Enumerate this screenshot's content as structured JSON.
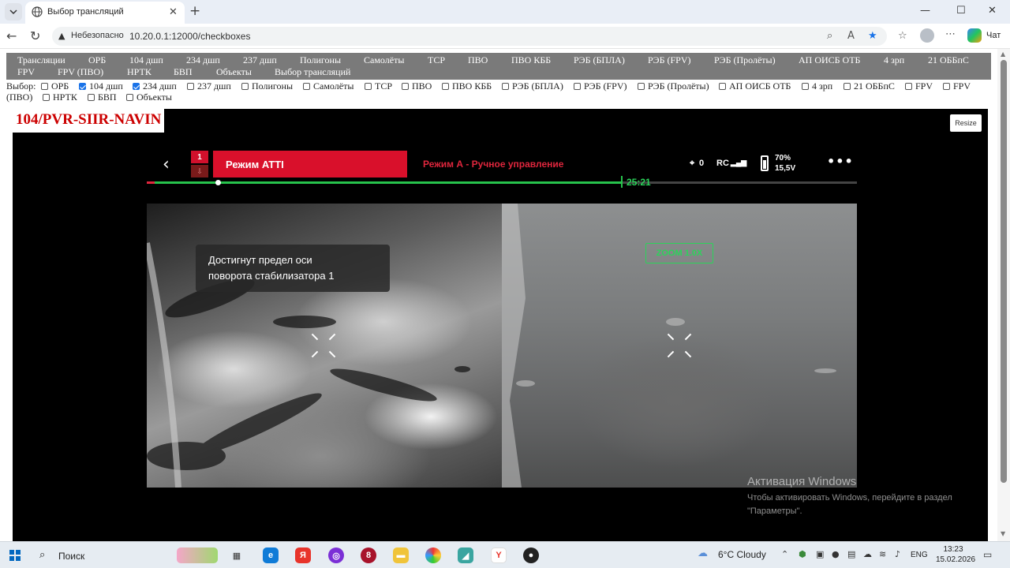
{
  "browser": {
    "tab_title": "Выбор трансляций",
    "tab_close": "✕",
    "new_tab": "+",
    "window_controls": [
      "—",
      "☐",
      "✕"
    ],
    "address": {
      "security_label": "Небезопасно",
      "url": "10.20.0.1:12000/checkboxes"
    },
    "chat_label": "Чат"
  },
  "menu": {
    "items": [
      "Трансляции",
      "ОРБ",
      "104 дшп",
      "234 дшп",
      "237 дшп",
      "Полигоны",
      "Самолёты",
      "ТСР",
      "ПВО",
      "ПВО КББ",
      "РЭБ (БПЛА)",
      "РЭБ (FPV)",
      "РЭБ (Пролёты)",
      "АП ОИСБ ОТБ",
      "4 зрп",
      "21 ОББпС",
      "FPV",
      "FPV (ПВО)",
      "НРТК",
      "БВП",
      "Объекты",
      "Выбор трансляций"
    ]
  },
  "selection": {
    "label": "Выбор:",
    "options": [
      {
        "label": "ОРБ",
        "checked": false
      },
      {
        "label": "104 дшп",
        "checked": true
      },
      {
        "label": "234 дшп",
        "checked": true
      },
      {
        "label": "237 дшп",
        "checked": false
      },
      {
        "label": "Полигоны",
        "checked": false
      },
      {
        "label": "Самолёты",
        "checked": false
      },
      {
        "label": "ТСР",
        "checked": false
      },
      {
        "label": "ПВО",
        "checked": false
      },
      {
        "label": "ПВО КББ",
        "checked": false
      },
      {
        "label": "РЭБ (БПЛА)",
        "checked": false
      },
      {
        "label": "РЭБ (FPV)",
        "checked": false
      },
      {
        "label": "РЭБ (Пролёты)",
        "checked": false
      },
      {
        "label": "АП ОИСБ ОТБ",
        "checked": false
      },
      {
        "label": "4 зрп",
        "checked": false
      },
      {
        "label": "21 ОББпС",
        "checked": false
      },
      {
        "label": "FPV",
        "checked": false
      },
      {
        "label": "FPV",
        "checked": false
      },
      {
        "label": "НРТК",
        "checked": false
      },
      {
        "label": "БВП",
        "checked": false
      },
      {
        "label": "Объекты",
        "checked": false
      }
    ],
    "wrap_text": "(ПВО)"
  },
  "stream": {
    "title": "104/PVR-SIIR-NAVIN",
    "resize_label": "Resize",
    "hud": {
      "back": "‹",
      "badge_top": "1",
      "badge_bottom": "⇩",
      "mode": "Режим ATTI",
      "mode_sub": "Режим А - Ручное управление",
      "satellites": "0",
      "rc": "RC",
      "battery_percent": "70%",
      "battery_voltage": "15,5V",
      "more": "•••",
      "timer": "25:21",
      "progress": 0.67,
      "notice_line1": "Достигнут предел оси",
      "notice_line2": "поворота стабилизатора 1",
      "zoom": "ZOOM 1.0X"
    }
  },
  "watermark": {
    "title": "Активация Windows",
    "text": "Чтобы активировать Windows, перейдите в раздел \"Параметры\"."
  },
  "taskbar": {
    "search_label": "Поиск",
    "weather": "6°C  Cloudy",
    "lang": "ENG",
    "time": "13:23",
    "date": "15.02.2026"
  },
  "colors": {
    "menu_bg": "#7a7a7a",
    "stream_title": "#cc0000",
    "hud_red": "#d9102b",
    "hud_green": "#27c24c"
  }
}
